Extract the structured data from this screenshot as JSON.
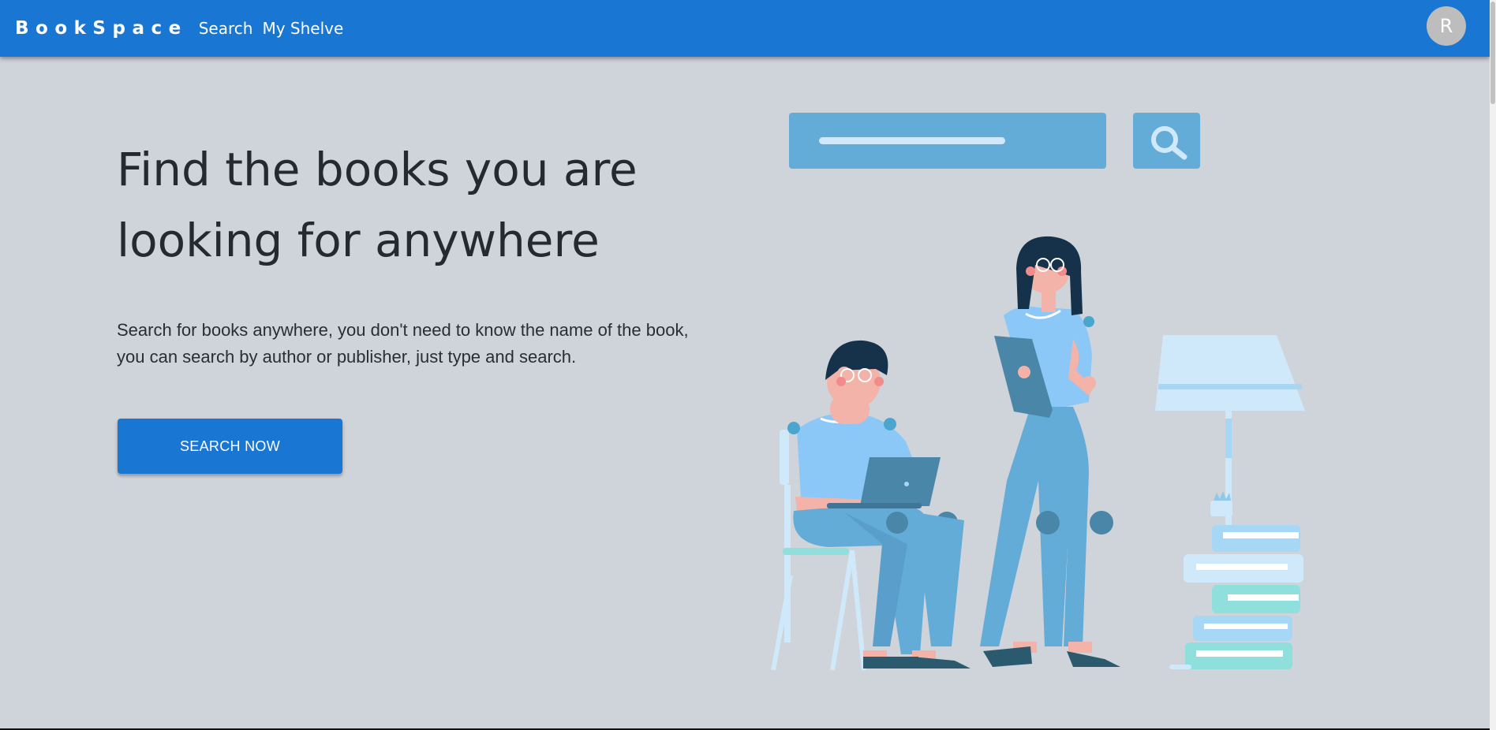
{
  "header": {
    "brand": "BookSpace",
    "nav": [
      "Search",
      "My Shelve"
    ],
    "avatar_initial": "R"
  },
  "hero": {
    "title_line1": "Find the books you are",
    "title_line2": "looking for anywhere",
    "description_line1": "Search for books anywhere, you don't need to know the name of the book,",
    "description_line2": "you can search by author or publisher, just type and search.",
    "cta_label": "SEARCH NOW"
  },
  "colors": {
    "primary": "#1976d2",
    "background": "#cfd3da",
    "illustration_blue": "#64acd8",
    "illustration_light": "#cfe9fb",
    "illustration_teal": "#8fe0dc"
  }
}
